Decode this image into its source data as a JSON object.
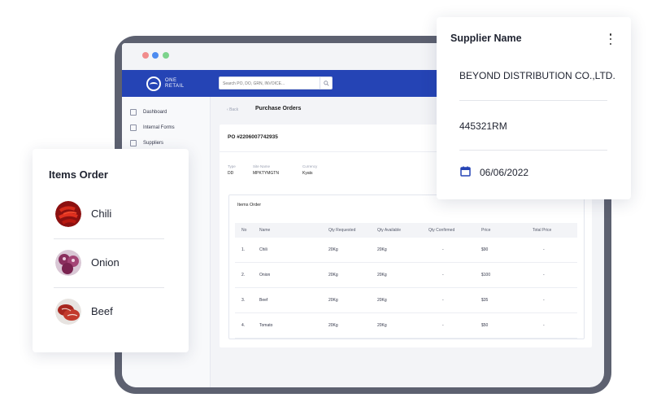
{
  "brand": {
    "line1": "ONE",
    "line2": "RETAIL"
  },
  "search": {
    "placeholder": "Search PO, DO, GRN, INVOICE..."
  },
  "sidebar": {
    "items": [
      {
        "label": "Dashboard",
        "icon": "home-icon"
      },
      {
        "label": "Internal Forms",
        "icon": "form-icon"
      },
      {
        "label": "Suppliers",
        "icon": "supplier-icon"
      }
    ]
  },
  "header": {
    "back": "Back",
    "title": "Purchase Orders"
  },
  "po": {
    "number": "PO #2206007742935",
    "meta": [
      {
        "label": "Type",
        "value": "DD"
      },
      {
        "label": "Site Name",
        "value": "MPKTYMGTN"
      },
      {
        "label": "Currency",
        "value": "Kyats"
      }
    ]
  },
  "items_table": {
    "title": "Items Order",
    "columns": [
      "No",
      "Name",
      "Qty Requested",
      "Qty Available",
      "Qty Confirmed",
      "Price",
      "Total Price"
    ],
    "rows": [
      [
        "1.",
        "Chili",
        "20Kg",
        "20Kg",
        "-",
        "$90",
        "-"
      ],
      [
        "2.",
        "Onion",
        "20Kg",
        "20Kg",
        "-",
        "$100",
        "-"
      ],
      [
        "3.",
        "Beef",
        "20Kg",
        "20Kg",
        "-",
        "$35",
        "-"
      ],
      [
        "4.",
        "Tomato",
        "20Kg",
        "20Kg",
        "-",
        "$50",
        "-"
      ]
    ]
  },
  "items_card": {
    "title": "Items Order",
    "items": [
      {
        "name": "Chili"
      },
      {
        "name": "Onion"
      },
      {
        "name": "Beef"
      }
    ]
  },
  "supplier_card": {
    "title": "Supplier Name",
    "name": "BEYOND DISTRIBUTION CO.,LTD.",
    "code": "445321RM",
    "date": "06/06/2022"
  },
  "colors": {
    "accent": "#2544b5",
    "frame": "#5d6170"
  }
}
